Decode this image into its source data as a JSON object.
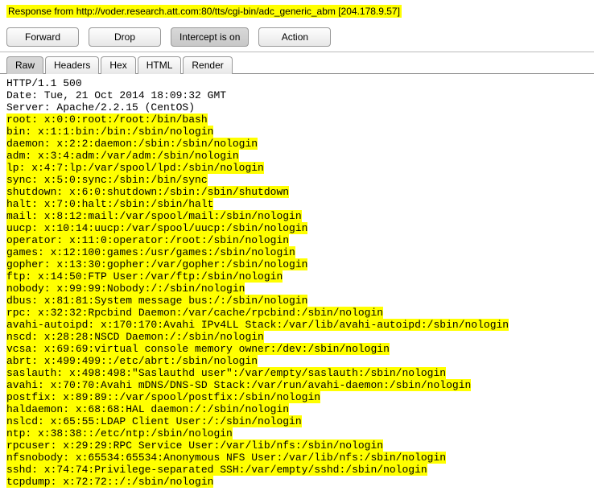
{
  "header": {
    "label": "Response from http://voder.research.att.com:80/tts/cgi-bin/adc_generic_abm  [204.178.9.57]"
  },
  "buttons": {
    "forward": "Forward",
    "drop": "Drop",
    "intercept": "Intercept is on",
    "action": "Action"
  },
  "tabs": {
    "raw": "Raw",
    "headers": "Headers",
    "hex": "Hex",
    "html": "HTML",
    "render": "Render"
  },
  "response": {
    "plain_lines": [
      "HTTP/1.1 500",
      "Date: Tue, 21 Oct 2014 18:09:32 GMT",
      "Server: Apache/2.2.15 (CentOS)"
    ],
    "highlighted_lines": [
      "root: x:0:0:root:/root:/bin/bash",
      "bin: x:1:1:bin:/bin:/sbin/nologin",
      "daemon: x:2:2:daemon:/sbin:/sbin/nologin",
      "adm: x:3:4:adm:/var/adm:/sbin/nologin",
      "lp: x:4:7:lp:/var/spool/lpd:/sbin/nologin",
      "sync: x:5:0:sync:/sbin:/bin/sync",
      "shutdown: x:6:0:shutdown:/sbin:/sbin/shutdown",
      "halt: x:7:0:halt:/sbin:/sbin/halt",
      "mail: x:8:12:mail:/var/spool/mail:/sbin/nologin",
      "uucp: x:10:14:uucp:/var/spool/uucp:/sbin/nologin",
      "operator: x:11:0:operator:/root:/sbin/nologin",
      "games: x:12:100:games:/usr/games:/sbin/nologin",
      "gopher: x:13:30:gopher:/var/gopher:/sbin/nologin",
      "ftp: x:14:50:FTP User:/var/ftp:/sbin/nologin",
      "nobody: x:99:99:Nobody:/:/sbin/nologin",
      "dbus: x:81:81:System message bus:/:/sbin/nologin",
      "rpc: x:32:32:Rpcbind Daemon:/var/cache/rpcbind:/sbin/nologin",
      "avahi-autoipd: x:170:170:Avahi IPv4LL Stack:/var/lib/avahi-autoipd:/sbin/nologin",
      "nscd: x:28:28:NSCD Daemon:/:/sbin/nologin",
      "vcsa: x:69:69:virtual console memory owner:/dev:/sbin/nologin",
      "abrt: x:499:499::/etc/abrt:/sbin/nologin",
      "saslauth: x:498:498:\"Saslauthd user\":/var/empty/saslauth:/sbin/nologin",
      "avahi: x:70:70:Avahi mDNS/DNS-SD Stack:/var/run/avahi-daemon:/sbin/nologin",
      "postfix: x:89:89::/var/spool/postfix:/sbin/nologin",
      "haldaemon: x:68:68:HAL daemon:/:/sbin/nologin",
      "nslcd: x:65:55:LDAP Client User:/:/sbin/nologin",
      "ntp: x:38:38::/etc/ntp:/sbin/nologin",
      "rpcuser: x:29:29:RPC Service User:/var/lib/nfs:/sbin/nologin",
      "nfsnobody: x:65534:65534:Anonymous NFS User:/var/lib/nfs:/sbin/nologin",
      "sshd: x:74:74:Privilege-separated SSH:/var/empty/sshd:/sbin/nologin",
      "tcpdump: x:72:72::/:/sbin/nologin"
    ]
  }
}
